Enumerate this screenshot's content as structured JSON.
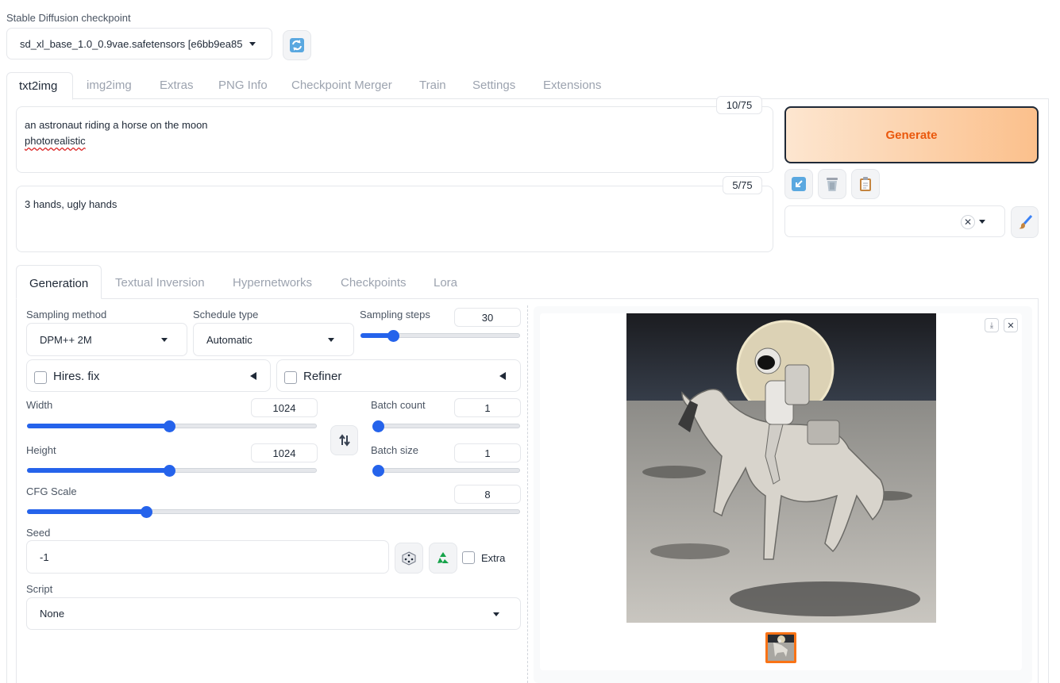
{
  "checkpoint": {
    "label": "Stable Diffusion checkpoint",
    "value": "sd_xl_base_1.0_0.9vae.safetensors [e6bb9ea85"
  },
  "main_tabs": [
    {
      "label": "txt2img"
    },
    {
      "label": "img2img"
    },
    {
      "label": "Extras"
    },
    {
      "label": "PNG Info"
    },
    {
      "label": "Checkpoint Merger"
    },
    {
      "label": "Train"
    },
    {
      "label": "Settings"
    },
    {
      "label": "Extensions"
    }
  ],
  "prompt": {
    "line1": "an astronaut riding a horse on the moon",
    "line2": "photorealistic",
    "token_count": "10/75"
  },
  "negative_prompt": {
    "value": "3 hands, ugly hands",
    "token_count": "5/75"
  },
  "generate_label": "Generate",
  "sub_tabs": [
    {
      "label": "Generation"
    },
    {
      "label": "Textual Inversion"
    },
    {
      "label": "Hypernetworks"
    },
    {
      "label": "Checkpoints"
    },
    {
      "label": "Lora"
    }
  ],
  "sampling_method": {
    "label": "Sampling method",
    "value": "DPM++ 2M"
  },
  "schedule_type": {
    "label": "Schedule type",
    "value": "Automatic"
  },
  "sampling_steps": {
    "label": "Sampling steps",
    "value": "30",
    "fraction": 0.2
  },
  "hires_fix": {
    "label": "Hires. fix"
  },
  "refiner": {
    "label": "Refiner"
  },
  "width": {
    "label": "Width",
    "value": "1024",
    "fraction": 0.49
  },
  "height": {
    "label": "Height",
    "value": "1024",
    "fraction": 0.49
  },
  "batch_count": {
    "label": "Batch count",
    "value": "1",
    "fraction": 0.0
  },
  "batch_size": {
    "label": "Batch size",
    "value": "1",
    "fraction": 0.0
  },
  "cfg_scale": {
    "label": "CFG Scale",
    "value": "8",
    "fraction": 0.24
  },
  "seed": {
    "label": "Seed",
    "value": "-1",
    "extra_label": "Extra"
  },
  "script": {
    "label": "Script",
    "value": "None"
  },
  "icons": {
    "refresh": "refresh-icon",
    "swap": "swap-dimensions-icon",
    "dice": "dice-icon",
    "recycle": "recycle-icon",
    "brush": "paintbrush-icon",
    "trash": "trash-icon",
    "clipboard": "clipboard-icon",
    "arrow": "arrow-icon"
  },
  "colors": {
    "accent": "#2563eb",
    "generate_text": "#ea580c",
    "generate_bg": "#fcd9b6"
  }
}
